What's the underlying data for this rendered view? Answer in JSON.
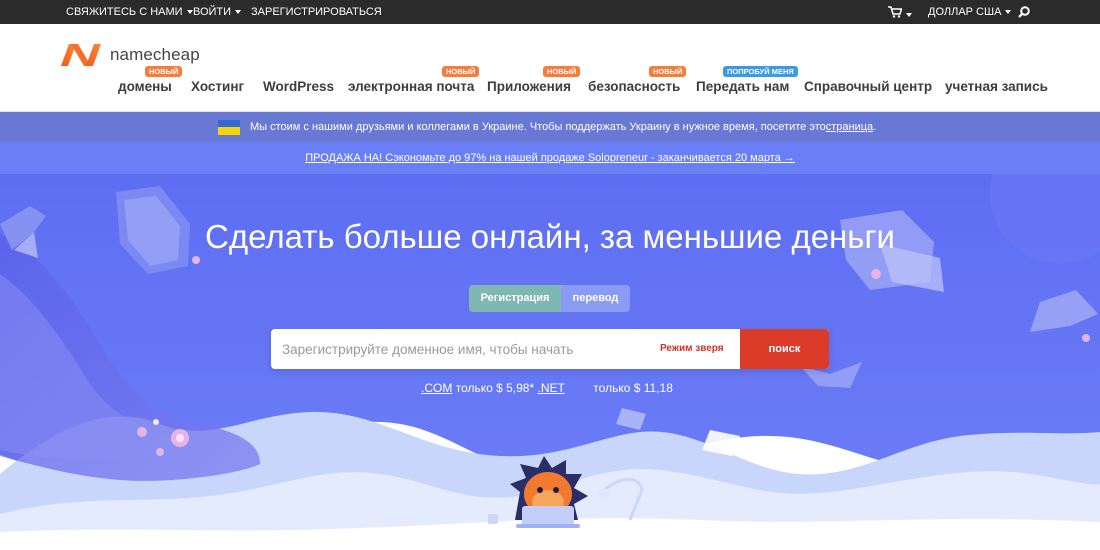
{
  "topbar": {
    "contact": "СВЯЖИТЕСЬ С НАМИ",
    "login": "ВОЙТИ",
    "register": "ЗАРЕГИСТРИРОВАТЬСЯ",
    "currency": "ДОЛЛАР США"
  },
  "logo": {
    "text": "namecheap"
  },
  "nav": {
    "domains": {
      "label": "домены",
      "badge": "новый"
    },
    "hosting": {
      "label": "Хостинг"
    },
    "wordpress": {
      "label": "WordPress"
    },
    "email": {
      "label": "электронная почта",
      "badge": "новый"
    },
    "apps": {
      "label": "Приложения",
      "badge": "новый"
    },
    "security": {
      "label": "безопасность",
      "badge": "новый"
    },
    "transfer": {
      "label": "Передать нам",
      "badge": "попробуй меня"
    },
    "help": {
      "label": "Справочный центр"
    },
    "account": {
      "label": "учетная запись"
    }
  },
  "ukraine": {
    "text": "Мы стоим с нашими друзьями и коллегами в Украине. Чтобы поддержать Украину в нужное время, посетите это",
    "link": "страница",
    "end": "."
  },
  "promo": {
    "text": "ПРОДАЖА НА! Сэкономьте до 97% на нашей продаже Solopreneur - заканчивается 20 марта →"
  },
  "hero": {
    "title": "Сделать больше онлайн, за меньшие деньги",
    "tabs": {
      "register": "Регистрация",
      "transfer": "перевод"
    },
    "search_placeholder": "Зарегистрируйте доменное имя, чтобы начать",
    "beast_mode": "Режим зверя",
    "search_button": "поиск",
    "prices": {
      "com_tld": ".COM",
      "com_text": "только $ 5,98*",
      "net_tld": ".NET",
      "net_text": "только $ 11,18"
    }
  },
  "colors": {
    "brand_orange": "#f25a24",
    "search_red": "#dc3b2a",
    "hero_blue": "#5f6ff2"
  }
}
